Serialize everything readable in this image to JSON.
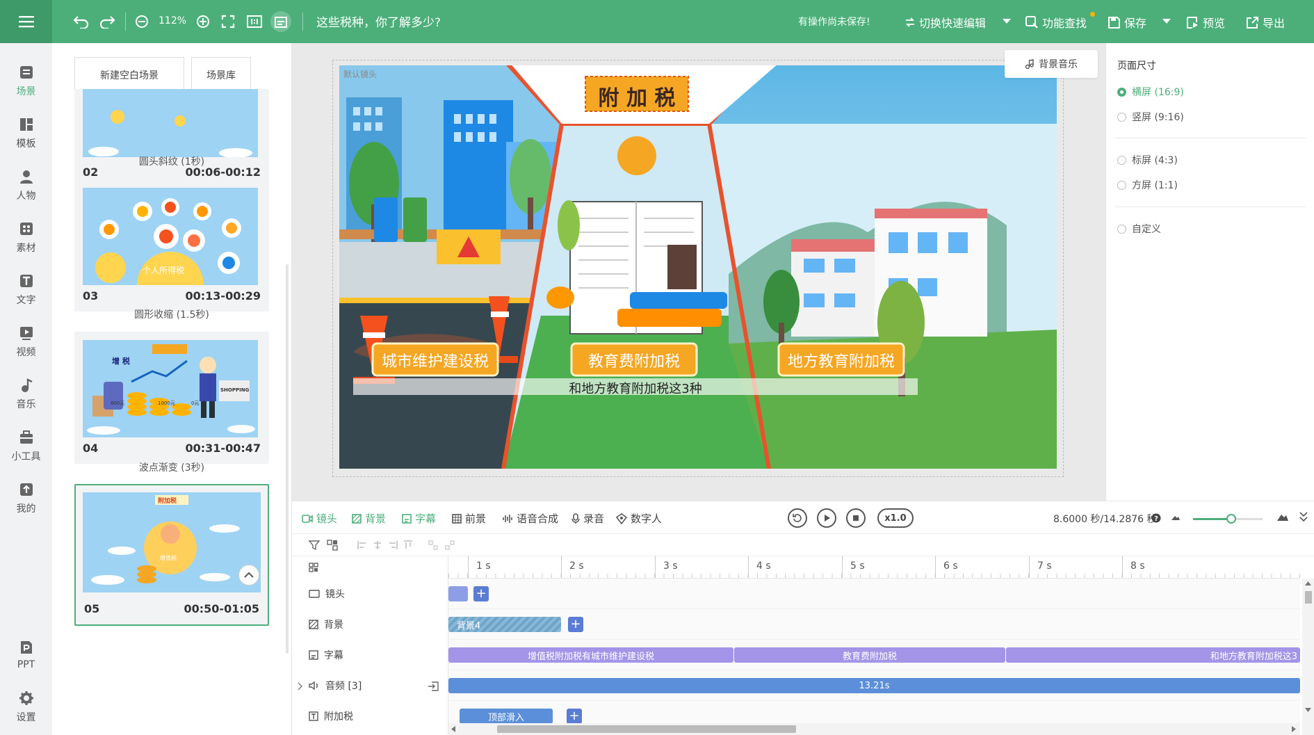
{
  "topbar": {
    "zoom": "112%",
    "doc_title": "这些税种，你了解多少?",
    "unsaved_text": "有操作尚未保存!",
    "switch_label": "切换快速编辑",
    "find_label": "功能查找",
    "save_label": "保存",
    "preview_label": "预览",
    "export_label": "导出"
  },
  "leftnav": {
    "items": [
      {
        "label": "场景",
        "icon": "scene-icon"
      },
      {
        "label": "模板",
        "icon": "template-icon"
      },
      {
        "label": "人物",
        "icon": "person-icon"
      },
      {
        "label": "素材",
        "icon": "material-icon"
      },
      {
        "label": "文字",
        "icon": "text-icon"
      },
      {
        "label": "视频",
        "icon": "video-icon"
      },
      {
        "label": "音乐",
        "icon": "music-icon"
      },
      {
        "label": "小工具",
        "icon": "toolbox-icon"
      },
      {
        "label": "我的",
        "icon": "upload-icon"
      },
      {
        "label": "PPT",
        "icon": "ppt-icon"
      },
      {
        "label": "设置",
        "icon": "gear-icon"
      }
    ]
  },
  "scenes": {
    "new_blank": "新建空白场景",
    "library": "场景库",
    "list": [
      {
        "num": "02",
        "time": "00:06-00:12"
      },
      {
        "num": "03",
        "time": "00:13-00:29",
        "caption": "个人所得税"
      },
      {
        "num": "04",
        "time": "00:31-00:47",
        "caption": "增 税",
        "price1": "800元",
        "price2": "1000元",
        "price3": "0元",
        "shop": "SHOPPING"
      },
      {
        "num": "05",
        "time": "00:50-01:05",
        "caption": "附加税",
        "badge": "增值税"
      }
    ],
    "transitions": [
      "圆头斜纹 (1秒)",
      "圆形收缩 (1.5秒)",
      "波点渐变 (3秒)"
    ]
  },
  "canvas": {
    "default_lens": "默认镜头",
    "title": "附 加 税",
    "label_left": "城市维护建设税",
    "label_mid": "教育费附加税",
    "label_right": "地方教育附加税",
    "subtitle": "和地方教育附加税这3种",
    "bgm_label": "背景音乐"
  },
  "page_size": {
    "title": "页面尺寸",
    "options": [
      {
        "label": "横屏 (16:9)",
        "selected": true
      },
      {
        "label": "竖屏 (9:16)",
        "selected": false
      },
      {
        "label": "标屏 (4:3)",
        "selected": false
      },
      {
        "label": "方屏 (1:1)",
        "selected": false
      },
      {
        "label": "自定义",
        "selected": false
      }
    ]
  },
  "timeline": {
    "tabs": [
      "镜头",
      "背景",
      "字幕",
      "前景",
      "语音合成",
      "录音",
      "数字人"
    ],
    "speed": "x1.0",
    "time_readout": "8.6000 秒/14.2876 秒",
    "zoom_level": 0.55,
    "ruler": [
      "1 s",
      "2 s",
      "3 s",
      "4 s",
      "5 s",
      "6 s",
      "7 s",
      "8 s"
    ],
    "tracks": {
      "lens": "镜头",
      "background": "背景",
      "subtitle": "字幕",
      "audio": "音频 [3]",
      "extra": "附加税"
    },
    "clips": {
      "bg": "背景4",
      "sub1": "增值税附加税有城市维护建设税",
      "sub2": "教育费附加税",
      "sub3": "和地方教育附加税这3",
      "audio": "13.21s",
      "extra": "顶部滑入"
    }
  },
  "colors": {
    "brand": "#4caf7a",
    "clip_purple": "#a394e8",
    "clip_blue": "#5b8fd9",
    "title_orange": "#f5a623"
  }
}
